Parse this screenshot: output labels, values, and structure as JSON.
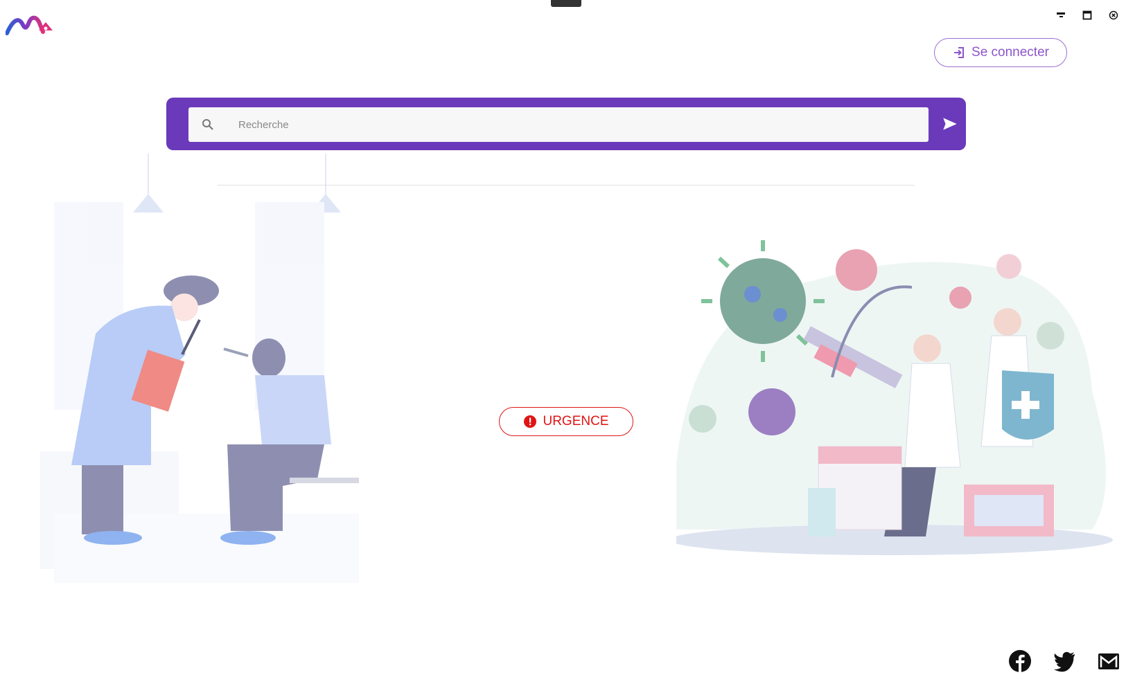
{
  "header": {
    "logo_icon": "brand-logo",
    "login_label": "Se connecter",
    "login_icon": "login-icon",
    "window_controls": [
      "minimize-icon",
      "maximize-icon",
      "close-icon"
    ]
  },
  "search": {
    "placeholder": "Recherche",
    "value": "",
    "search_icon": "search-icon",
    "submit_icon": "send-icon"
  },
  "main": {
    "urgence_label": "URGENCE",
    "urgence_icon": "alert-icon"
  },
  "footer": {
    "social": [
      "facebook-icon",
      "twitter-icon",
      "mail-icon"
    ]
  },
  "colors": {
    "primary": "#6a3aba",
    "accent": "#8c55cc",
    "danger": "#e01414"
  }
}
